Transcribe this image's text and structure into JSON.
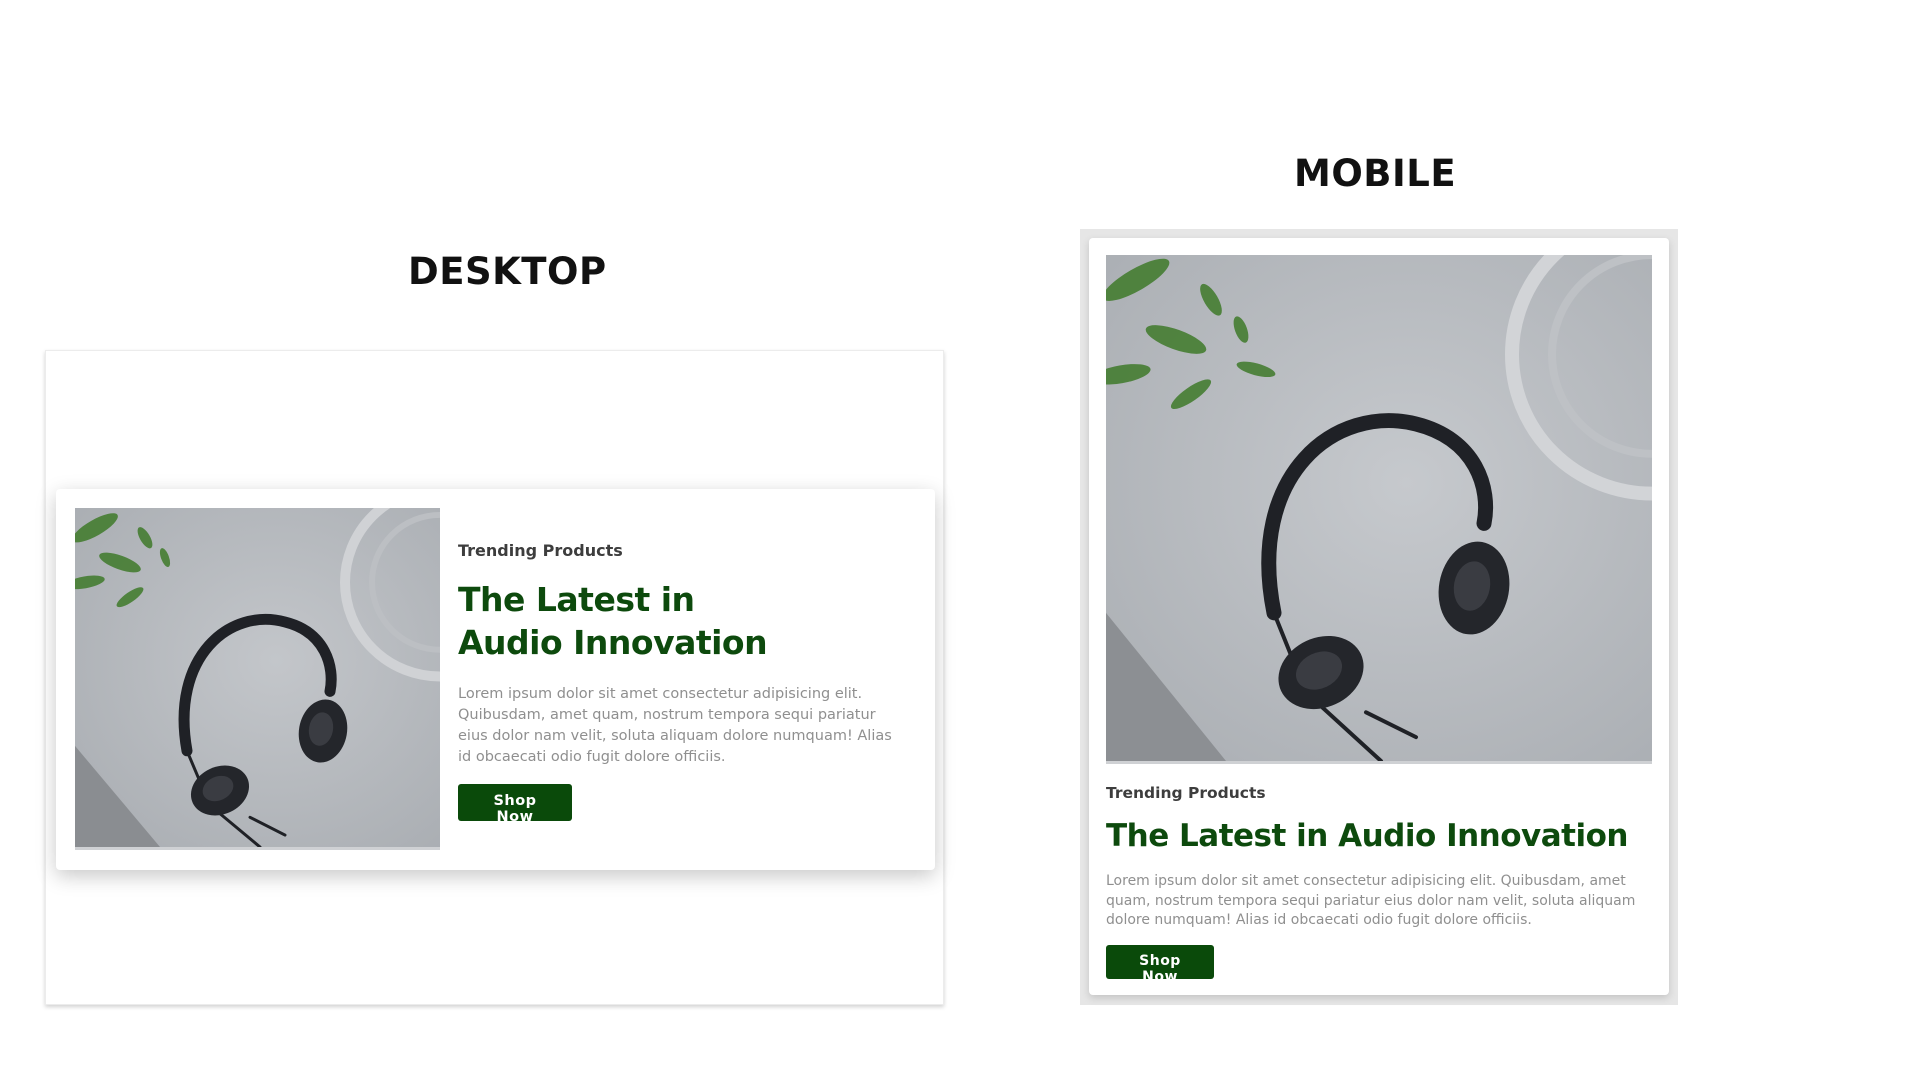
{
  "labels": {
    "desktop": "DESKTOP",
    "mobile": "MOBILE"
  },
  "card": {
    "eyebrow": "Trending Products",
    "headline": "The Latest in Audio Innovation",
    "body": "Lorem ipsum dolor sit amet consectetur adipisicing elit. Quibusdam, amet quam, nostrum tempora sequi pariatur eius dolor nam velit, soluta aliquam dolore numquam! Alias id obcaecati odio fugit dolore officiis.",
    "cta_label": "Shop Now",
    "image_icon": "headphones-photo-icon"
  },
  "colors": {
    "accent": "#0a4a0a",
    "headline": "#0d4a0d",
    "body_text": "#8f8f8f",
    "eyebrow": "#3d3d3d"
  }
}
